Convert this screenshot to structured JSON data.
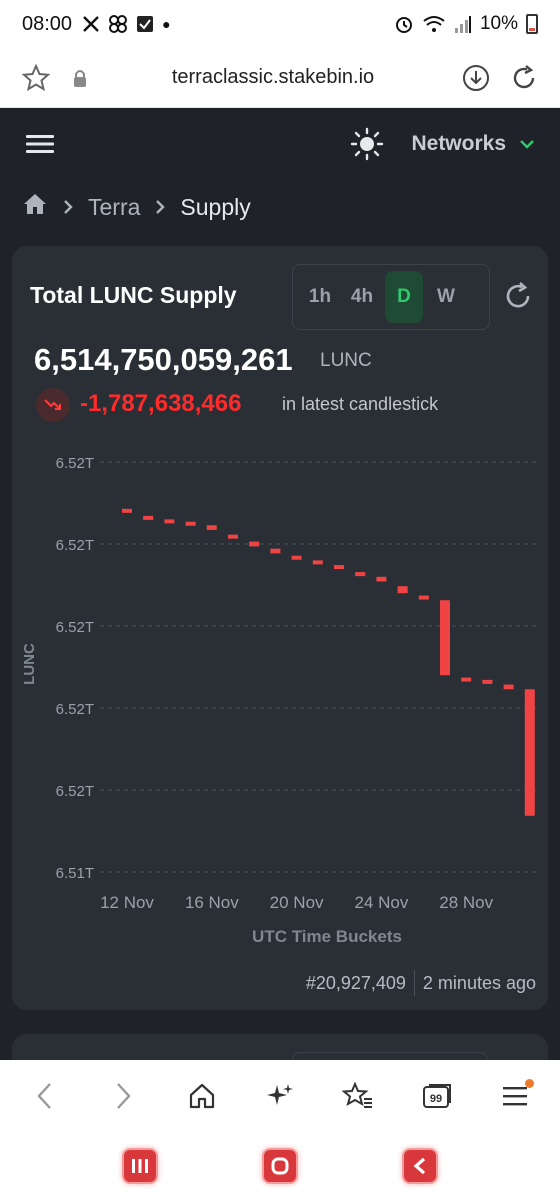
{
  "status_bar": {
    "time": "08:00",
    "battery": "10%"
  },
  "browser": {
    "url": "terraclassic.stakebin.io",
    "tab_count": "99"
  },
  "nav": {
    "networks_label": "Networks"
  },
  "breadcrumb": {
    "items": [
      "Terra",
      "Supply"
    ]
  },
  "card": {
    "title": "Total LUNC Supply",
    "timeframes": [
      "1h",
      "4h",
      "D",
      "W"
    ],
    "active_timeframe": "D",
    "supply_value": "6,514,750,059,261",
    "supply_unit": "LUNC",
    "delta": "-1,787,638,466",
    "delta_suffix": "in latest candlestick",
    "block": "#20,927,409",
    "updated": "2 minutes ago"
  },
  "colors": {
    "accent_green": "#2fca6b",
    "negative_red": "#ff2b2b",
    "candle_red": "#f04444",
    "card_bg": "#2a2f36",
    "page_bg": "#1f2329"
  },
  "chart_data": {
    "type": "candlestick",
    "ylabel": "LUNC",
    "xlabel": "UTC Time Buckets",
    "y_tick_labels": [
      "6.52T",
      "6.52T",
      "6.52T",
      "6.52T",
      "6.52T",
      "6.51T"
    ],
    "x_tick_labels": [
      "12 Nov",
      "16 Nov",
      "20 Nov",
      "24 Nov",
      "28 Nov"
    ],
    "grid": "horizontal dashed",
    "series": [
      {
        "values_note": "daily candles, all decreasing",
        "candles": [
          {
            "date": "2024-11-12",
            "open": 6.5275,
            "close": 6.5274
          },
          {
            "date": "2024-11-13",
            "open": 6.5272,
            "close": 6.52715
          },
          {
            "date": "2024-11-14",
            "open": 6.52705,
            "close": 6.527
          },
          {
            "date": "2024-11-15",
            "open": 6.52695,
            "close": 6.5269
          },
          {
            "date": "2024-11-16",
            "open": 6.5268,
            "close": 6.5266
          },
          {
            "date": "2024-11-17",
            "open": 6.5264,
            "close": 6.52635
          },
          {
            "date": "2024-11-18",
            "open": 6.5261,
            "close": 6.5259
          },
          {
            "date": "2024-11-19",
            "open": 6.5258,
            "close": 6.5256
          },
          {
            "date": "2024-11-20",
            "open": 6.5255,
            "close": 6.5254
          },
          {
            "date": "2024-11-21",
            "open": 6.5253,
            "close": 6.5252
          },
          {
            "date": "2024-11-22",
            "open": 6.5251,
            "close": 6.525
          },
          {
            "date": "2024-11-23",
            "open": 6.5248,
            "close": 6.5247
          },
          {
            "date": "2024-11-24",
            "open": 6.5246,
            "close": 6.5244
          },
          {
            "date": "2024-11-25",
            "open": 6.5242,
            "close": 6.5239
          },
          {
            "date": "2024-11-26",
            "open": 6.5238,
            "close": 6.5237
          },
          {
            "date": "2024-11-27",
            "open": 6.5236,
            "close": 6.5204
          },
          {
            "date": "2024-11-28",
            "open": 6.5203,
            "close": 6.5202
          },
          {
            "date": "2024-11-29",
            "open": 6.5202,
            "close": 6.5201
          },
          {
            "date": "2024-11-30",
            "open": 6.52,
            "close": 6.5198
          },
          {
            "date": "2024-12-01",
            "open": 6.5198,
            "close": 6.5144
          }
        ]
      }
    ]
  }
}
